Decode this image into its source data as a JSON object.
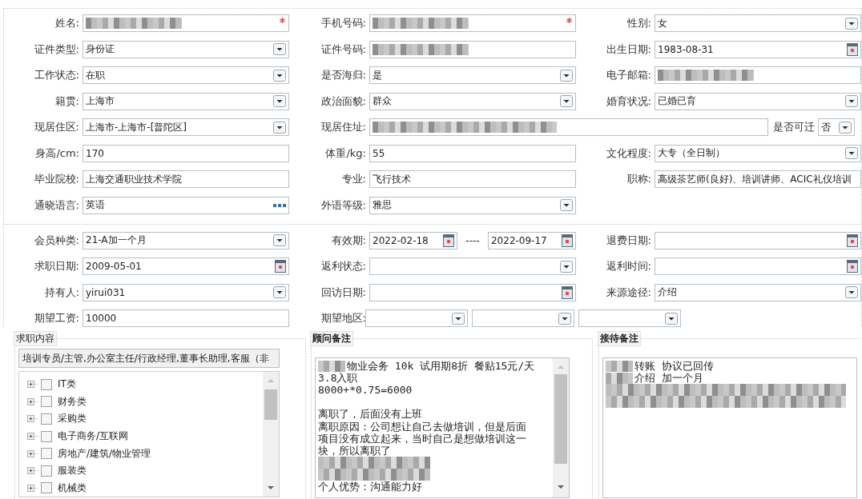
{
  "personal": {
    "rows": [
      [
        {
          "label": "姓名:",
          "kind": "text",
          "redacted": true,
          "required": true
        },
        {
          "label": "手机号码:",
          "kind": "text",
          "redacted": true,
          "required": true
        },
        {
          "label": "性别:",
          "kind": "select",
          "value": "女"
        }
      ],
      [
        {
          "label": "证件类型:",
          "kind": "select",
          "value": "身份证"
        },
        {
          "label": "证件号码:",
          "kind": "text",
          "redacted": true
        },
        {
          "label": "出生日期:",
          "kind": "date",
          "value": "1983-08-31"
        }
      ],
      [
        {
          "label": "工作状态:",
          "kind": "select",
          "value": "在职"
        },
        {
          "label": "是否海归:",
          "kind": "select",
          "value": "是"
        },
        {
          "label": "电子邮箱:",
          "kind": "text",
          "redacted": true
        }
      ],
      [
        {
          "label": "籍贯:",
          "kind": "select",
          "value": "上海市"
        },
        {
          "label": "政治面貌:",
          "kind": "select",
          "value": "群众"
        },
        {
          "label": "婚育状况:",
          "kind": "select",
          "value": "已婚已育"
        }
      ],
      [
        {
          "label": "现居住区:",
          "kind": "select",
          "value": "上海市-上海市-[普陀区]"
        },
        {
          "label": "现居住址:",
          "kind": "wide_text",
          "redacted": true
        },
        {
          "label": "是否可迁",
          "kind": "small_select",
          "value": "否"
        }
      ],
      [
        {
          "label": "身高/cm:",
          "kind": "text",
          "value": "170"
        },
        {
          "label": "体重/kg:",
          "kind": "text",
          "value": "55"
        },
        {
          "label": "文化程度:",
          "kind": "select",
          "value": "大专（全日制）"
        }
      ],
      [
        {
          "label": "毕业院校:",
          "kind": "text",
          "value": "上海交通职业技术学院"
        },
        {
          "label": "专业:",
          "kind": "text",
          "value": "飞行技术"
        },
        {
          "label": "职称:",
          "kind": "text",
          "value": "高级茶艺师(良好)、培训讲师、ACIC礼仪培训"
        }
      ],
      [
        {
          "label": "通晓语言:",
          "kind": "picker",
          "value": "英语"
        },
        {
          "label": "外语等级:",
          "kind": "select",
          "value": "雅思"
        }
      ]
    ]
  },
  "membership": {
    "rows": [
      [
        {
          "label": "会员种类:",
          "kind": "select",
          "value": "21-A加一个月"
        },
        {
          "label": "有效期:",
          "kind": "date_range",
          "start": "2022-02-18",
          "separator": "----",
          "end": "2022-09-17"
        },
        {
          "label": "退费日期:",
          "kind": "date"
        }
      ],
      [
        {
          "label": "求职日期:",
          "kind": "date",
          "value": "2009-05-01"
        },
        {
          "label": "返利状态:",
          "kind": "select"
        },
        {
          "label": "返利时间:",
          "kind": "date"
        }
      ],
      [
        {
          "label": "持有人:",
          "kind": "select",
          "value": "yirui031"
        },
        {
          "label": "回访日期:",
          "kind": "date"
        },
        {
          "label": "来源途径:",
          "kind": "select",
          "value": "介绍"
        }
      ],
      [
        {
          "label": "期望工资:",
          "kind": "text",
          "value": "10000"
        },
        {
          "label": "期望地区:",
          "kind": "multi_select",
          "selects": [
            {
              "kind": "select"
            },
            {
              "kind": "select"
            },
            {
              "kind": "select"
            }
          ]
        }
      ]
    ]
  },
  "panels": [
    {
      "kind": "categories",
      "title": "求职内容",
      "summary": "培训专员/主管,办公室主任/行政经理,董事长助理,客服（非",
      "items": [
        {
          "label": "IT类",
          "expanded": false,
          "checked": false
        },
        {
          "label": "财务类",
          "expanded": false,
          "checked": false
        },
        {
          "label": "采购类",
          "expanded": false,
          "checked": false
        },
        {
          "label": "电子商务/互联网",
          "expanded": false,
          "checked": false
        },
        {
          "label": "房地产/建筑/物业管理",
          "expanded": false,
          "checked": false
        },
        {
          "label": "服装类",
          "expanded": false,
          "checked": false
        },
        {
          "label": "机械类",
          "expanded": false,
          "checked": false
        }
      ]
    },
    {
      "kind": "notes",
      "title": "顾问备注",
      "scrollable": true,
      "lines": [
        {
          "kind": "text",
          "redacted_prefix": true,
          "text": "物业会务 10k 试用期8折 餐贴15元/天"
        },
        {
          "kind": "text",
          "text": "3.8入职"
        },
        {
          "kind": "text",
          "text": "8000+*0.75=6000"
        },
        {
          "kind": "blank"
        },
        {
          "kind": "text",
          "text": "离职了，后面没有上班"
        },
        {
          "kind": "text",
          "text": "离职原因：公司想让自己去做培训，但是后面"
        },
        {
          "kind": "text",
          "text": "项目没有成立起来，当时自己是想做培训这一"
        },
        {
          "kind": "text",
          "text": "块，所以离职了"
        },
        {
          "kind": "blur"
        },
        {
          "kind": "blur"
        },
        {
          "kind": "text",
          "text": "个人优势：沟通能力好"
        }
      ]
    },
    {
      "kind": "notes",
      "title": "接待备注",
      "scrollable": false,
      "lines": [
        {
          "kind": "text",
          "redacted_prefix": true,
          "text": "转账 协议已回传"
        },
        {
          "kind": "text",
          "redacted_prefix": true,
          "text": "介绍 加一个月"
        },
        {
          "kind": "blur"
        },
        {
          "kind": "blur"
        }
      ]
    }
  ]
}
